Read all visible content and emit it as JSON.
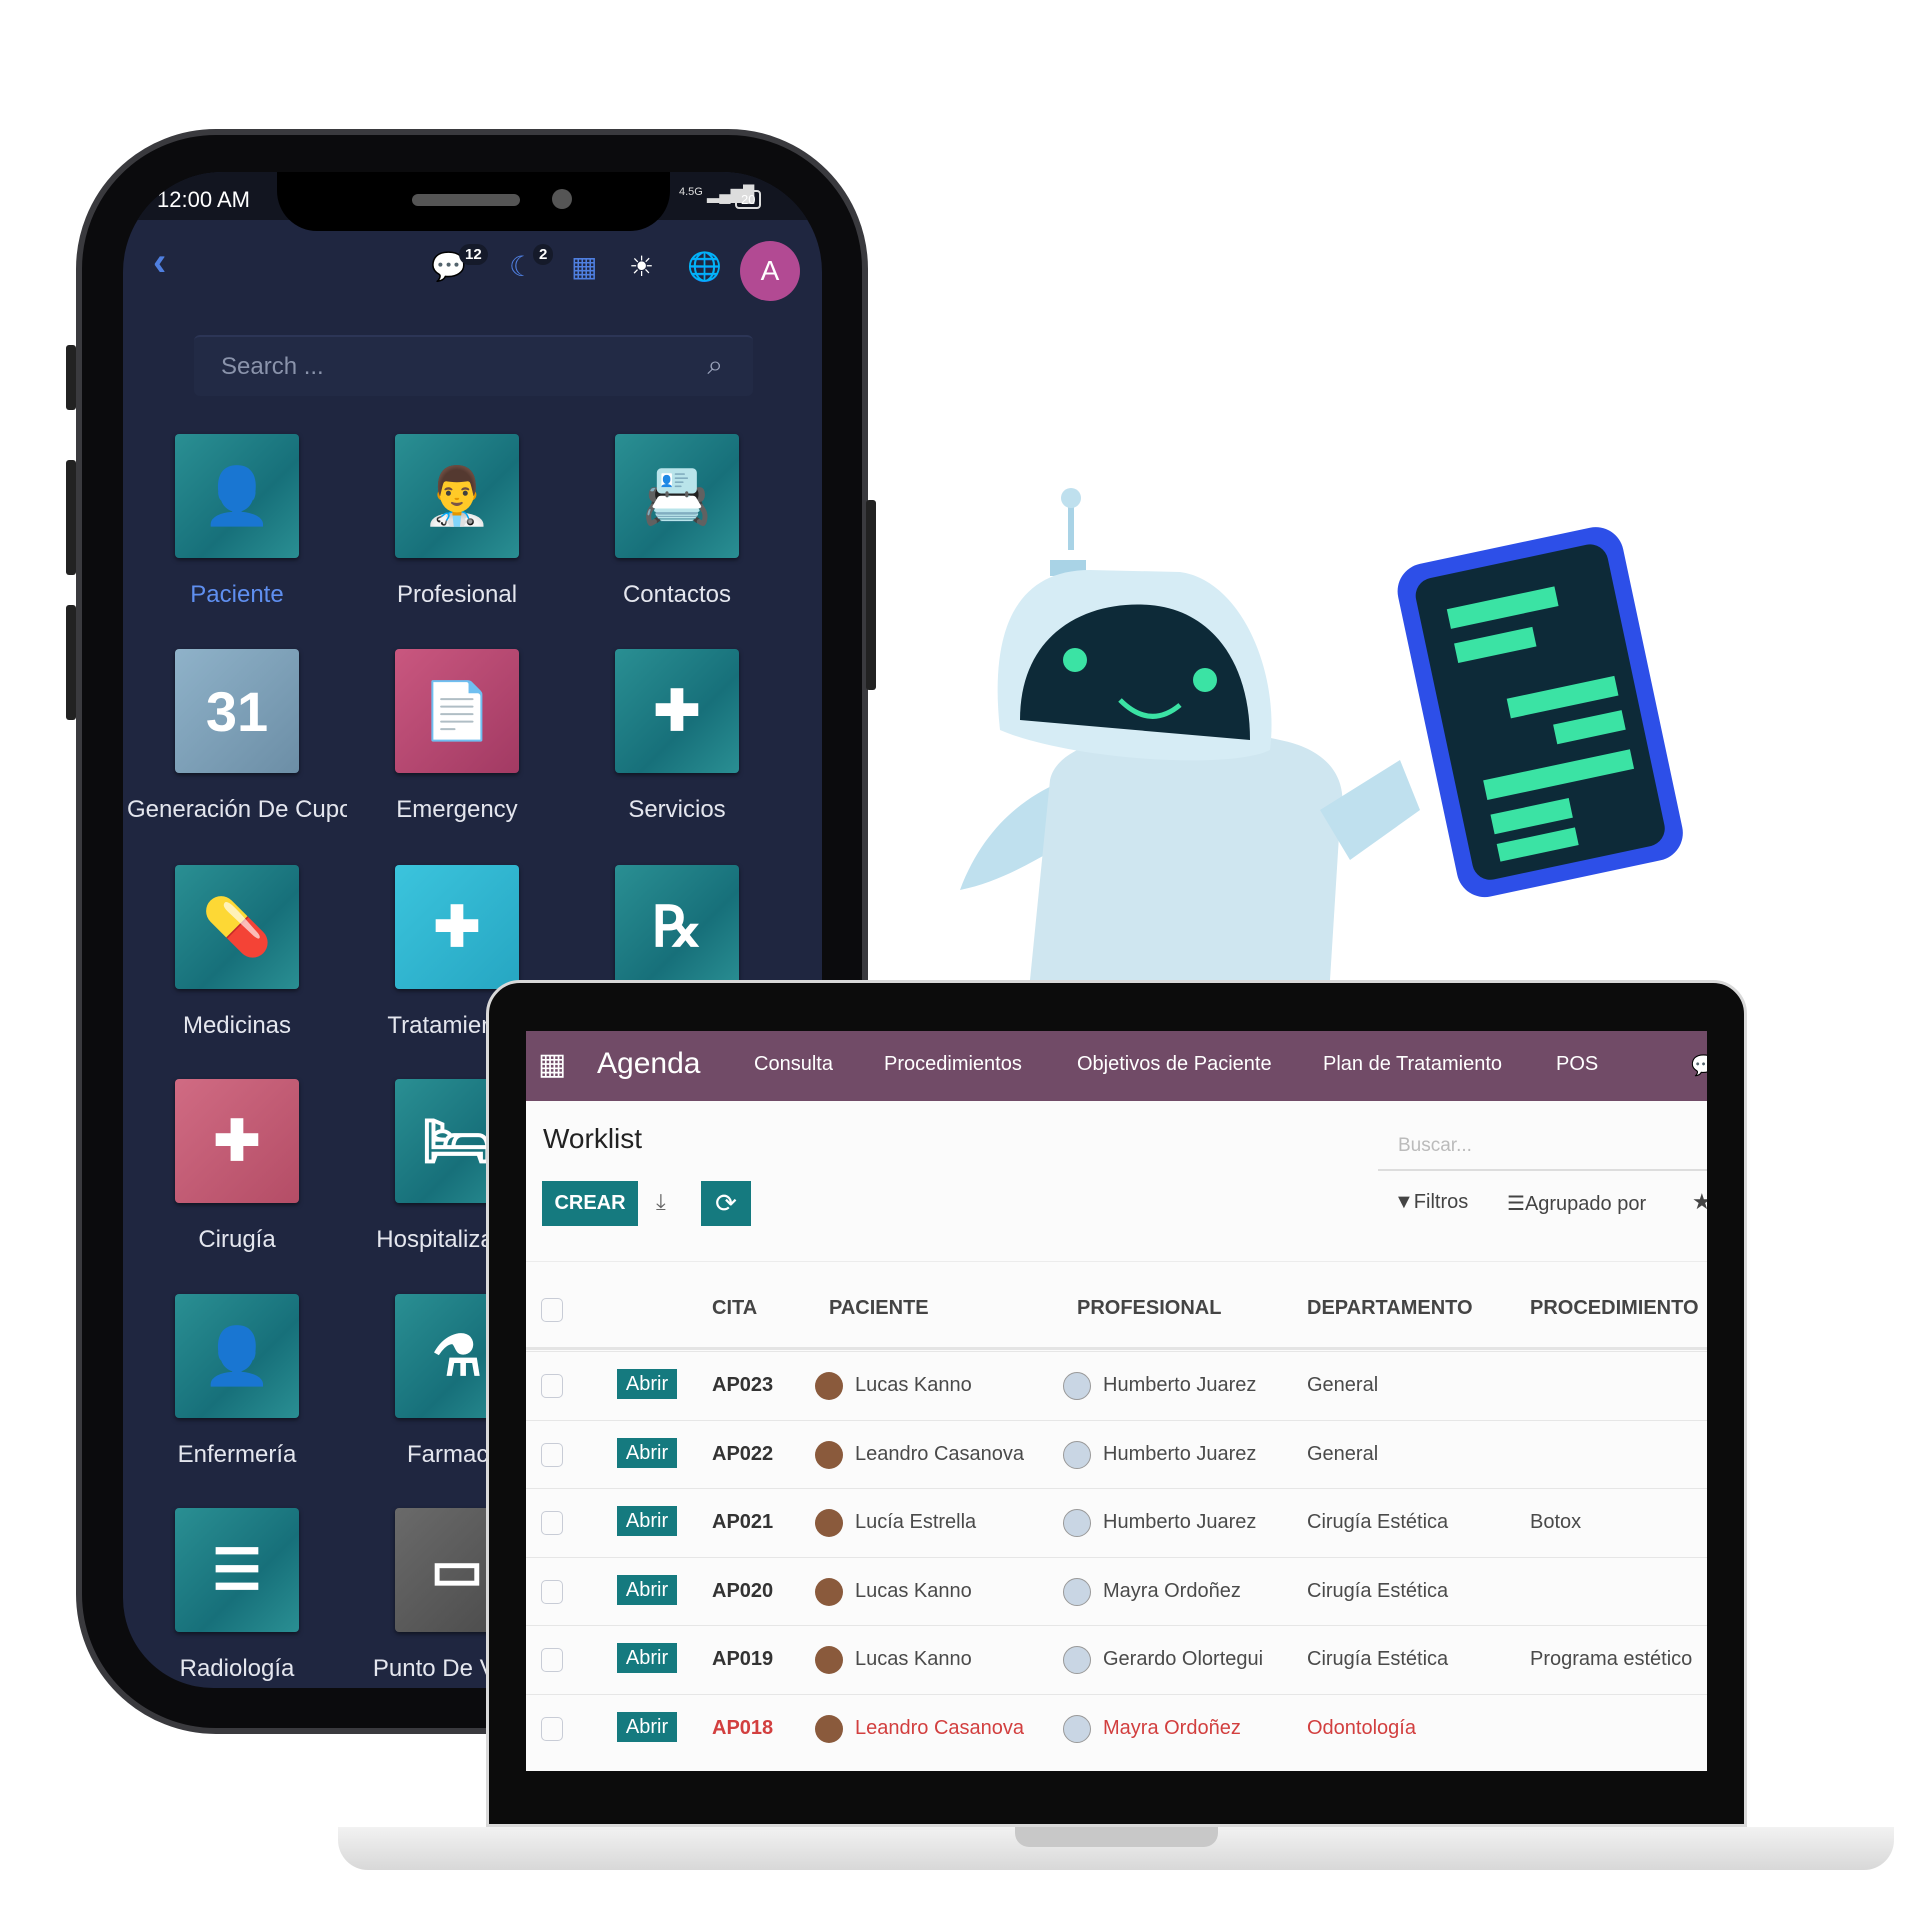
{
  "phone": {
    "status": {
      "time": "12:00 AM",
      "network": "4.5G",
      "battery": "20"
    },
    "topbar": {
      "chat_count": "12",
      "activity_count": "2",
      "avatar_letter": "A"
    },
    "search_placeholder": "Search ...",
    "apps": [
      {
        "label": "Paciente",
        "icon": "injured-patient-icon",
        "color": "teal",
        "active": true
      },
      {
        "label": "Profesional",
        "icon": "doctor-icon",
        "color": "teal"
      },
      {
        "label": "Contactos",
        "icon": "address-book-icon",
        "color": "teal"
      },
      {
        "label": "Generación De Cupos",
        "icon": "calendar-gear-icon",
        "color": "grey",
        "icon_text": "31"
      },
      {
        "label": "Emergency",
        "icon": "medical-file-icon",
        "color": "pink"
      },
      {
        "label": "Servicios",
        "icon": "first-aid-kit-icon",
        "color": "teal"
      },
      {
        "label": "Medicinas",
        "icon": "pills-icon",
        "color": "teal"
      },
      {
        "label": "Tratamientos",
        "icon": "hand-cross-icon",
        "color": "cyan"
      },
      {
        "label": "",
        "icon": "prescription-icon",
        "color": "teal",
        "icon_text": "℞"
      },
      {
        "label": "Cirugía",
        "icon": "surgery-stretcher-icon",
        "color": "rose"
      },
      {
        "label": "Hospitalización",
        "icon": "hospital-bed-icon",
        "color": "teal"
      },
      {
        "label": "",
        "icon": "",
        "color": "teal"
      },
      {
        "label": "Enfermería",
        "icon": "nurse-icon",
        "color": "teal"
      },
      {
        "label": "Farmacia",
        "icon": "mortar-icon",
        "color": "teal"
      },
      {
        "label": "",
        "icon": "",
        "color": "teal"
      },
      {
        "label": "Radiología",
        "icon": "xray-icon",
        "color": "teal"
      },
      {
        "label": "Punto De Venta",
        "icon": "store-icon",
        "color": "dark"
      }
    ]
  },
  "laptop": {
    "nav": {
      "app": "Agenda",
      "items": [
        "Consulta",
        "Procedimientos",
        "Objetivos de Paciente",
        "Plan de Tratamiento",
        "POS"
      ],
      "color": "#714b67"
    },
    "title": "Worklist",
    "search_placeholder": "Buscar...",
    "create_label": "CREAR",
    "filters_label": "Filtros",
    "group_label": "Agrupado por",
    "columns": [
      "CITA",
      "PACIENTE",
      "PROFESIONAL",
      "DEPARTAMENTO",
      "PROCEDIMIENTO"
    ],
    "open_label": "Abrir",
    "rows": [
      {
        "cita": "AP023",
        "paciente": "Lucas Kanno",
        "profesional": "Humberto Juarez",
        "departamento": "General",
        "procedimiento": ""
      },
      {
        "cita": "AP022",
        "paciente": "Leandro Casanova",
        "profesional": "Humberto Juarez",
        "departamento": "General",
        "procedimiento": ""
      },
      {
        "cita": "AP021",
        "paciente": "Lucía Estrella",
        "profesional": "Humberto Juarez",
        "departamento": "Cirugía Estética",
        "procedimiento": "Botox"
      },
      {
        "cita": "AP020",
        "paciente": "Lucas Kanno",
        "profesional": "Mayra Ordoñez",
        "departamento": "Cirugía Estética",
        "procedimiento": ""
      },
      {
        "cita": "AP019",
        "paciente": "Lucas Kanno",
        "profesional": "Gerardo Olortegui",
        "departamento": "Cirugía Estética",
        "procedimiento": "Programa estético"
      },
      {
        "cita": "AP018",
        "paciente": "Leandro Casanova",
        "profesional": "Mayra Ordoñez",
        "departamento": "Odontología",
        "procedimiento": "",
        "overdue": true
      }
    ]
  }
}
